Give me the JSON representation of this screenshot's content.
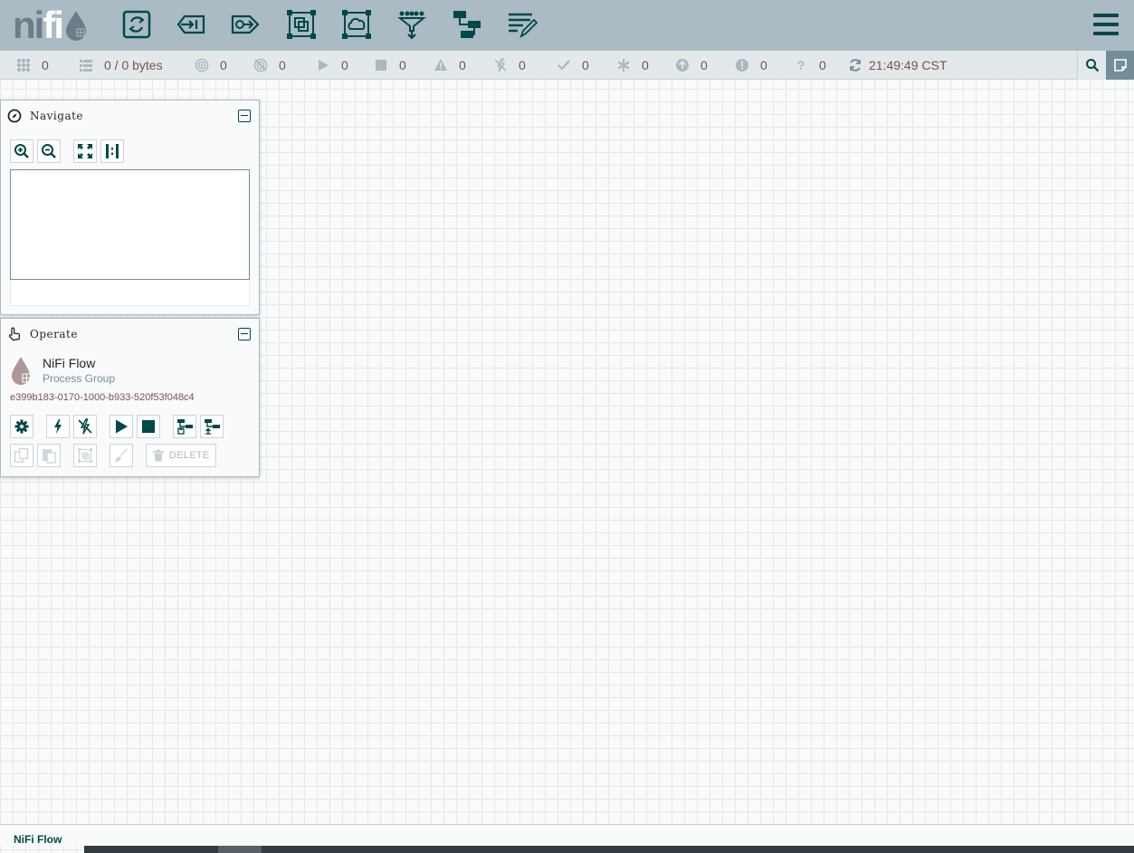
{
  "app": {
    "logo_text_a": "ni",
    "logo_text_b": "fi"
  },
  "toolbar": {
    "components": [
      {
        "name": "processor",
        "icon": "processor-icon"
      },
      {
        "name": "input-port",
        "icon": "input-port-icon"
      },
      {
        "name": "output-port",
        "icon": "output-port-icon"
      },
      {
        "name": "process-group",
        "icon": "process-group-icon"
      },
      {
        "name": "remote-process-group",
        "icon": "remote-process-group-icon"
      },
      {
        "name": "funnel",
        "icon": "funnel-icon"
      },
      {
        "name": "template",
        "icon": "template-icon"
      },
      {
        "name": "label",
        "icon": "label-icon"
      }
    ],
    "menu_icon": "hamburger-menu-icon"
  },
  "status": {
    "active_threads": "0",
    "queued": "0 / 0 bytes",
    "transmitting": "0",
    "not_transmitting": "0",
    "running": "0",
    "stopped": "0",
    "invalid": "0",
    "disabled": "0",
    "up_to_date": "0",
    "locally_modified": "0",
    "stale": "0",
    "errors": "0",
    "sync_failure": "0",
    "refresh_time": "21:49:49 CST"
  },
  "navigate": {
    "title": "Navigate"
  },
  "operate": {
    "title": "Operate",
    "component_name": "NiFi Flow",
    "component_type": "Process Group",
    "component_id": "e399b183-0170-1000-b933-520f53f048c4",
    "delete_label": "DELETE"
  },
  "breadcrumb": {
    "current": "NiFi Flow"
  },
  "colors": {
    "header_bg": "#aabbc3",
    "status_bg": "#e3e8eb",
    "accent": "#004849",
    "value_text": "#775351"
  }
}
